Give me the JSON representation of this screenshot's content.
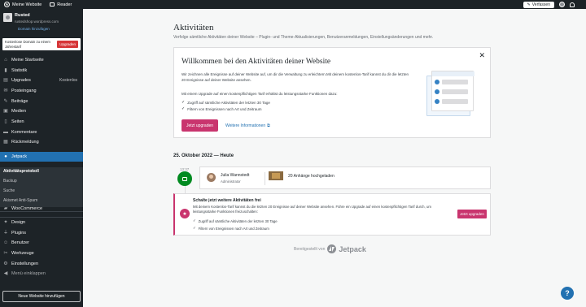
{
  "topbar": {
    "my_site": "Meine Website",
    "reader": "Reader",
    "write": "Verfassen"
  },
  "site": {
    "name": "Rusted",
    "url": "rustedshop.wordpress.com",
    "plan_link": "Domain hinzufügen"
  },
  "upsell_banner": {
    "text": "Kostenlose Domain zu einem Jahrestarif",
    "button": "Upgraden"
  },
  "menu": {
    "items": [
      {
        "label": "Meine Startseite",
        "icon": "home-icon"
      },
      {
        "label": "Statistik",
        "icon": "stats-icon"
      },
      {
        "label": "Upgrades",
        "icon": "upgrades-icon",
        "badge": "Kostenlos"
      },
      {
        "label": "Posteingang",
        "icon": "inbox-icon"
      },
      {
        "label": "Beiträge",
        "icon": "posts-icon"
      },
      {
        "label": "Medien",
        "icon": "media-icon"
      },
      {
        "label": "Seiten",
        "icon": "pages-icon"
      },
      {
        "label": "Kommentare",
        "icon": "comments-icon"
      },
      {
        "label": "Rückmeldung",
        "icon": "feedback-icon"
      },
      {
        "label": "Jetpack",
        "icon": "jetpack-icon"
      }
    ],
    "submenu": [
      "Aktivitätsprotokoll",
      "Backup",
      "Suche",
      "Akismet Anti-Spam"
    ],
    "lower_items": [
      {
        "label": "WooCommerce",
        "icon": "woocommerce-icon"
      },
      {
        "label": "Design",
        "icon": "design-icon"
      },
      {
        "label": "Plugins",
        "icon": "plugins-icon"
      },
      {
        "label": "Benutzer",
        "icon": "users-icon"
      },
      {
        "label": "Werkzeuge",
        "icon": "tools-icon"
      },
      {
        "label": "Einstellungen",
        "icon": "settings-icon"
      },
      {
        "label": "Menü einklappen",
        "icon": "collapse-icon"
      }
    ],
    "add_site": "Neue Website hinzufügen"
  },
  "page": {
    "title": "Aktivitäten",
    "subtitle": "Verfolge sämtliche Aktivitäten deiner Website – Plugin- und Theme-Aktualisierungen, Benutzeranmeldungen, Einstellungsänderungen und mehr."
  },
  "welcome": {
    "title": "Willkommen bei den Aktivitäten deiner Website",
    "desc": "Wir zeichnen alle Ereignisse auf deiner Website auf, um dir die Verwaltung zu erleichtern.Mit deinem kostenlos-Tarif kannst du dir die letzten 20 Ereignisse auf deiner Website ansehen.",
    "upgrade_intro": "Mit einem Upgrade auf einen kostenpflichtigen Tarif erhältst du leistungsstarke Funktionen dazu:",
    "features": [
      "Zugriff auf sämtliche Aktivitäten der letzten 30 Tage",
      "Filtern von Ereignissen nach Art und Zeitraum"
    ],
    "button": "Jetzt upgraden",
    "link": "Weitere Informationen"
  },
  "timeline": {
    "date": "25. Oktober 2022 — Heute",
    "time": "13:37",
    "actor_name": "Julia Wannstedt",
    "actor_role": "Administrator",
    "event": "20 Anhänge hochgeladen"
  },
  "upsell_card": {
    "title": "Schalte jetzt weitere Aktivitäten frei",
    "desc": "Mit deinem Kostenlos-Tarif kannst du die letzten 20 Ereignisse auf deiner Website ansehen. Führe ein Upgrade auf einen kostenpflichtigen Tarif durch, um leistungsstarke Funktionen freizuschalten:",
    "features": [
      "Zugriff auf sämtliche Aktivitäten der letzten 30 Tage",
      "Filtern von Ereignissen nach Art und Zeitraum"
    ],
    "button": "Jetzt upgraden"
  },
  "footer": {
    "powered_by": "Bereitgestellt von",
    "brand": "Jetpack"
  },
  "help": "?"
}
